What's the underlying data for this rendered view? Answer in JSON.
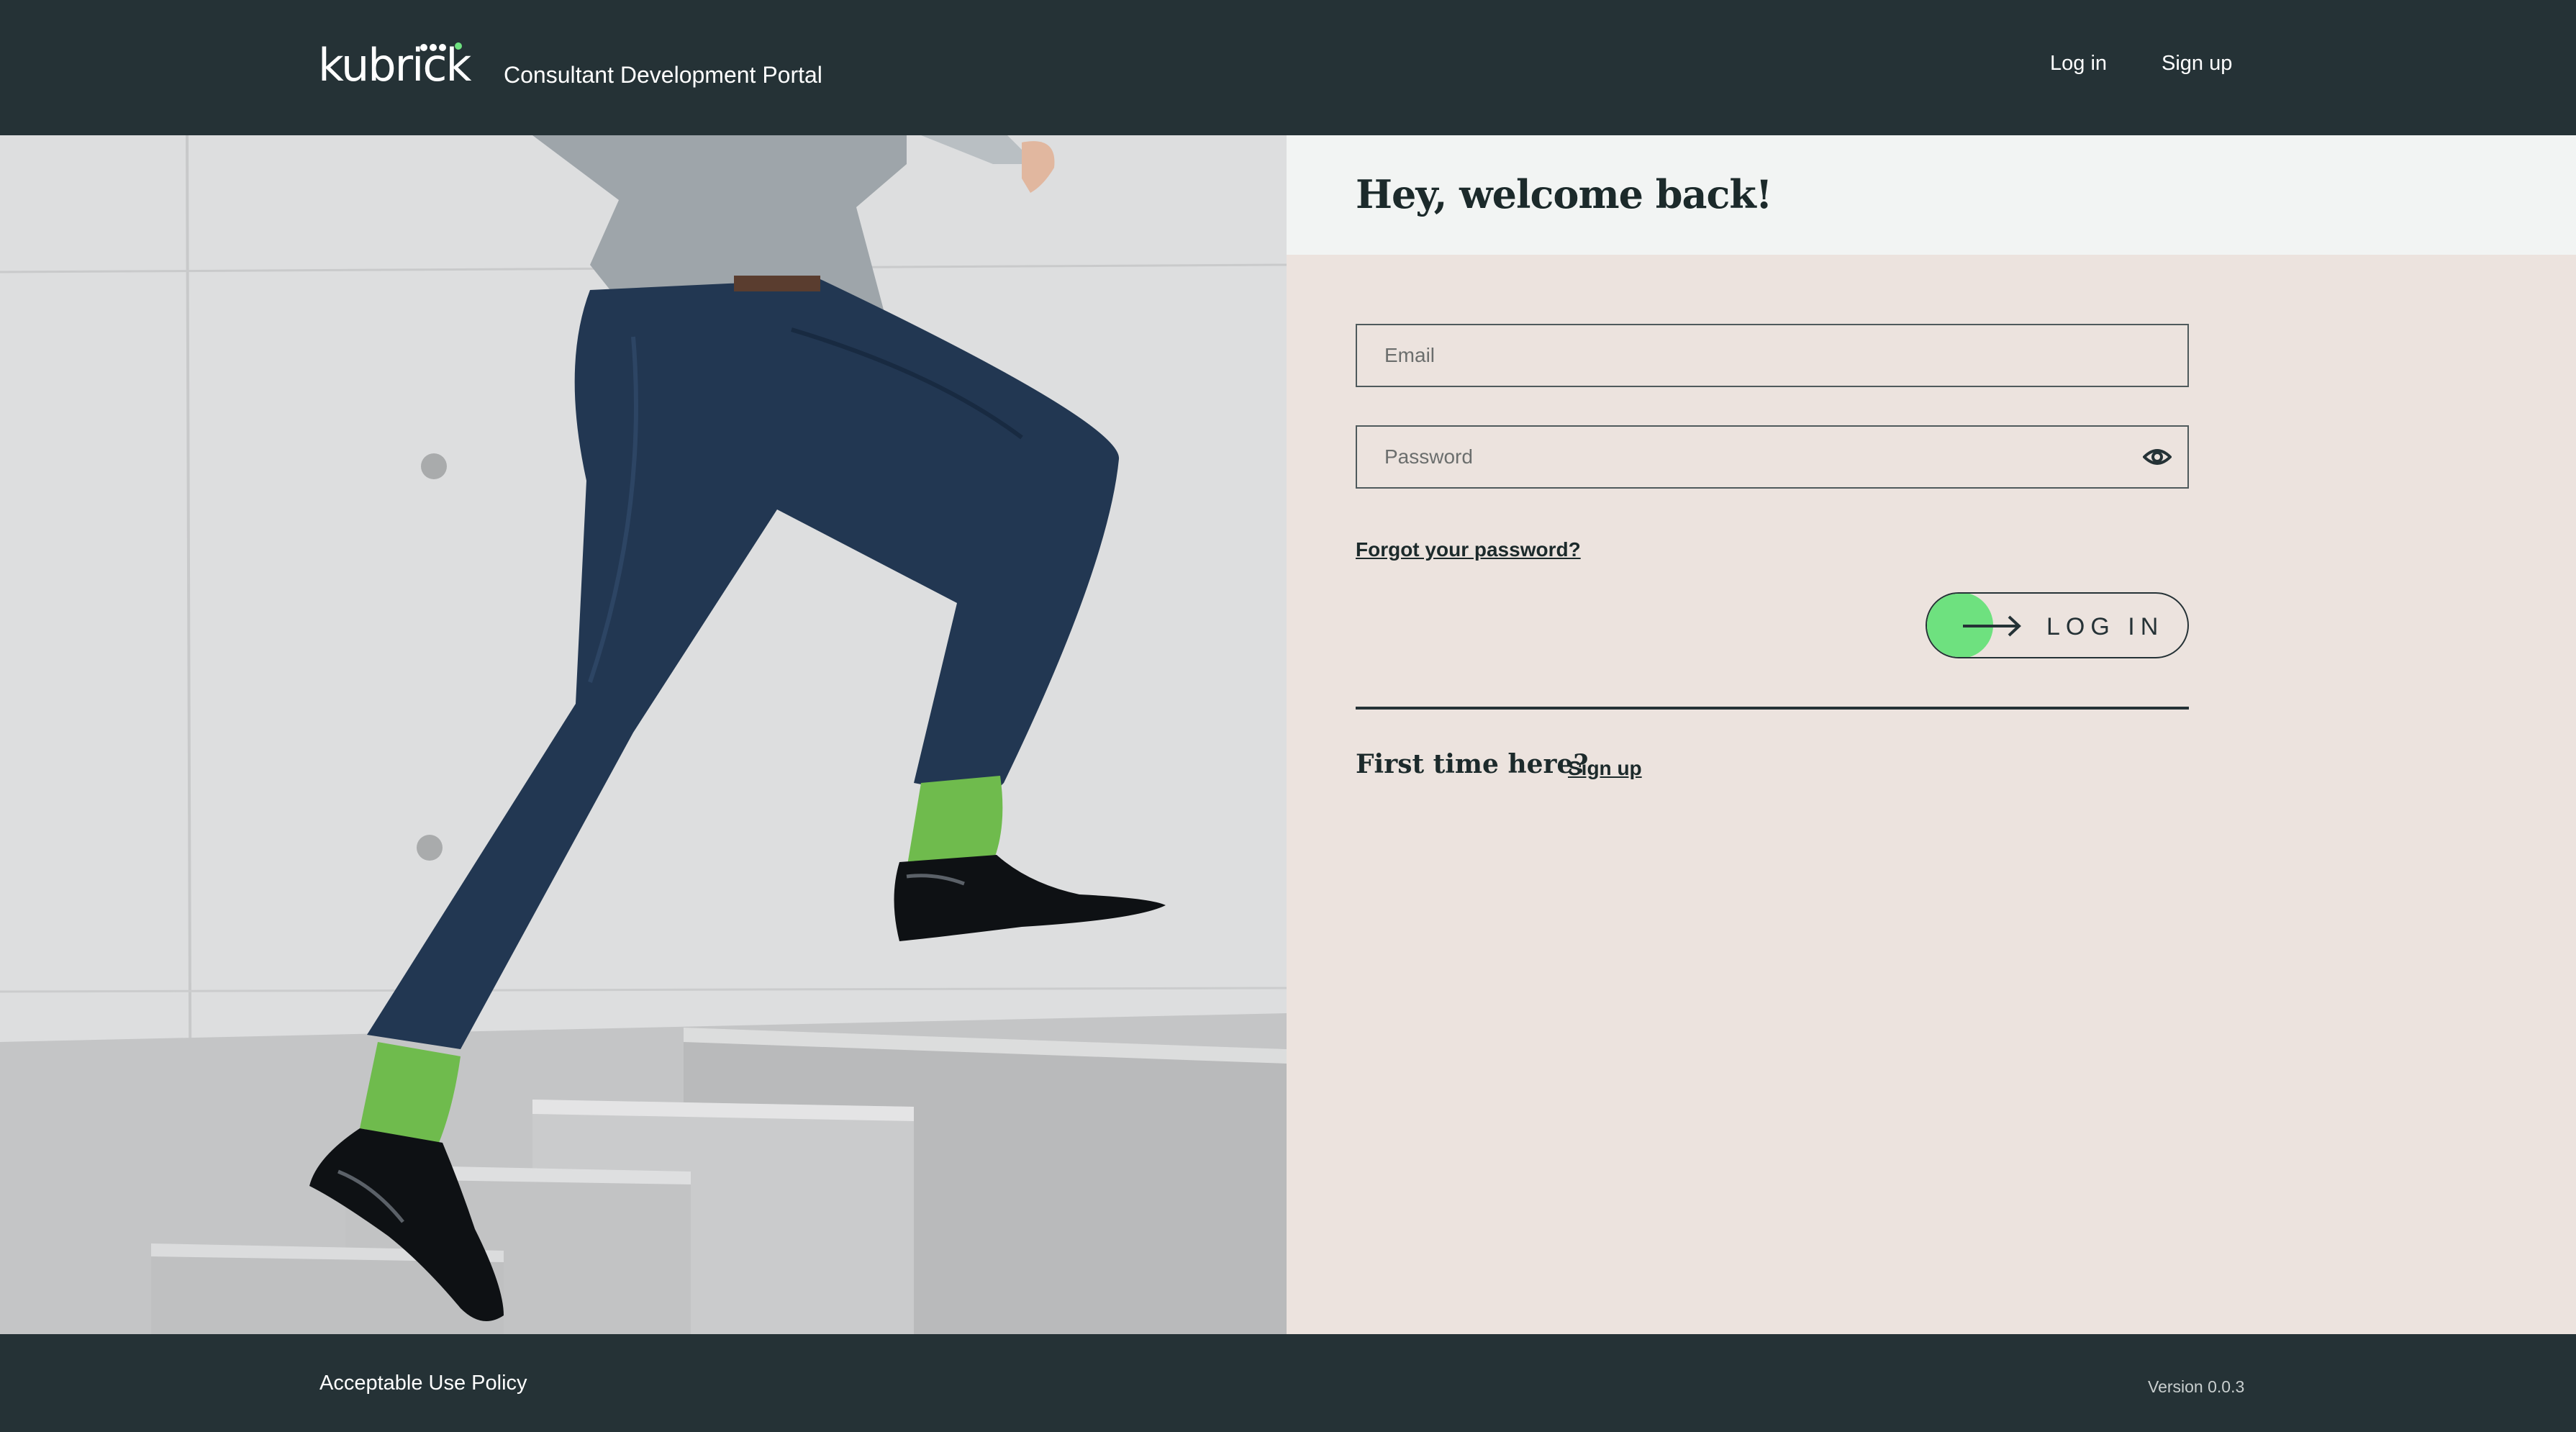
{
  "header": {
    "logo_text": "kubrick",
    "portal_title": "Consultant Development Portal",
    "nav": {
      "login_label": "Log in",
      "signup_label": "Sign up"
    }
  },
  "hero": {
    "image_subject": "person-climbing-stairs-green-socks"
  },
  "login_form": {
    "title": "Hey, welcome back!",
    "email_placeholder": "Email",
    "password_placeholder": "Password",
    "password_toggle_icon": "eye-icon",
    "forgot_label": "Forgot your password?",
    "login_button_label": "LOG IN",
    "login_button_icon": "arrow-right-icon",
    "accent_color": "#6ee17f",
    "first_time_text": "First time here?",
    "signup_label": "Sign up"
  },
  "footer": {
    "policy_label": "Acceptable Use Policy",
    "version": "Version 0.0.3"
  },
  "colors": {
    "header_bg": "#253236",
    "panel_bg": "#ece3de",
    "welcome_bg": "#f2f4f3",
    "accent": "#6ee17f"
  }
}
